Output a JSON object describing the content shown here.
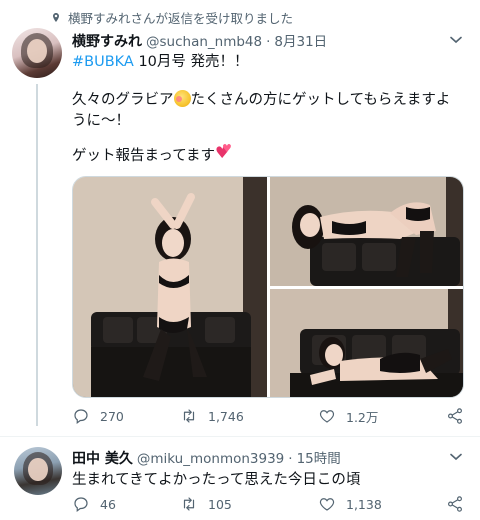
{
  "notice": {
    "text": "横野すみれさんが返信を受け取りました"
  },
  "tweet1": {
    "name": "横野すみれ",
    "handle": "@suchan_nmb48",
    "separator": "·",
    "time": "8月31日",
    "hashtag": "#BUBKA",
    "line1_rest": " 10月号 発売！！",
    "line2_a": "久々のグラビア",
    "line2_b": "たくさんの方にゲットしてもらえますように〜！",
    "line3": "ゲット報告まってます",
    "replies": "270",
    "retweets": "1,746",
    "likes": "1.2万"
  },
  "tweet2": {
    "name": "田中 美久",
    "handle": "@miku_monmon3939",
    "separator": "·",
    "time": "15時間",
    "text": "生まれてきてよかったって思えた今日この頃",
    "replies": "46",
    "retweets": "105",
    "likes": "1,138"
  },
  "icons": {
    "notice": "pin-icon",
    "reply": "reply-icon",
    "retweet": "retweet-icon",
    "like": "heart-icon",
    "share": "share-icon",
    "more": "chevron-down-icon"
  },
  "colors": {
    "accent": "#1d9bf0",
    "secondary_text": "#536471",
    "text": "#0f1419",
    "divider": "#eff3f4"
  }
}
